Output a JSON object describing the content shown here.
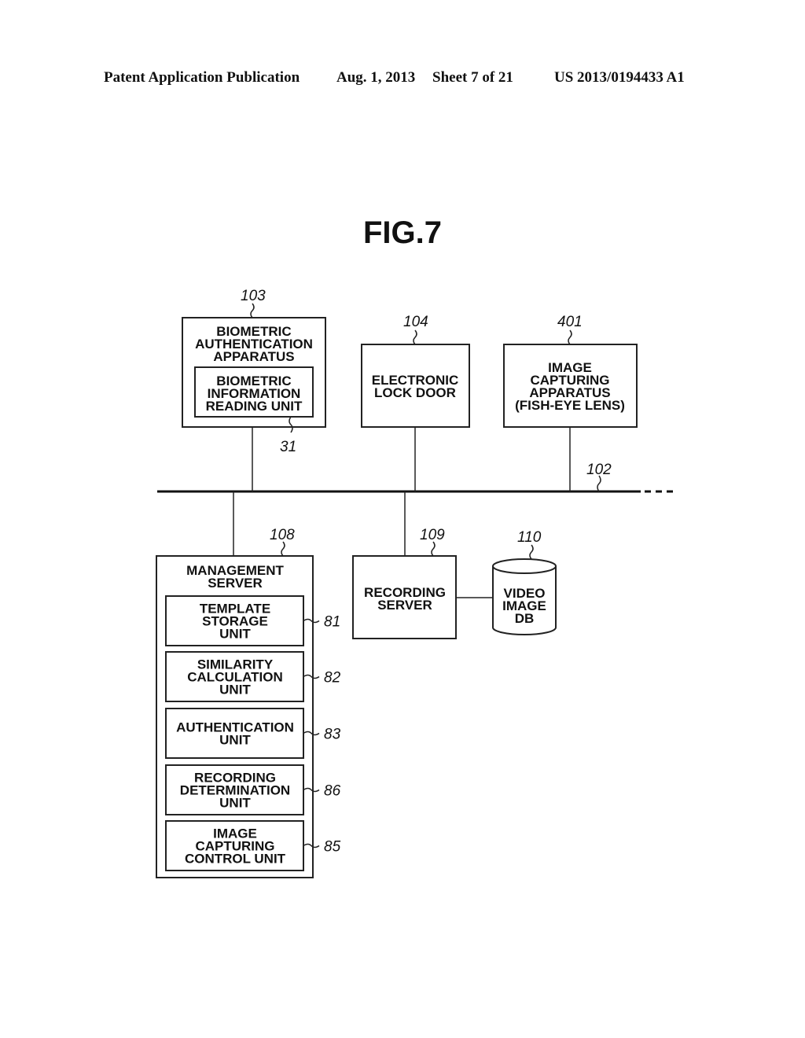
{
  "header": {
    "publication": "Patent Application Publication",
    "date": "Aug. 1, 2013",
    "sheet": "Sheet 7 of 21",
    "number": "US 2013/0194433 A1"
  },
  "figure": {
    "title": "FIG.7"
  },
  "network": {
    "ref": "102"
  },
  "blocks": {
    "biometric_auth": {
      "ref": "103",
      "lines": [
        "BIOMETRIC",
        "AUTHENTICATION",
        "APPARATUS"
      ]
    },
    "biometric_reader": {
      "ref": "31",
      "lines": [
        "BIOMETRIC",
        "INFORMATION",
        "READING UNIT"
      ]
    },
    "lock_door": {
      "ref": "104",
      "lines": [
        "ELECTRONIC",
        "LOCK DOOR"
      ]
    },
    "camera": {
      "ref": "401",
      "lines": [
        "IMAGE",
        "CAPTURING",
        "APPARATUS",
        "(FISH-EYE LENS)"
      ]
    },
    "management_server": {
      "ref": "108",
      "lines": [
        "MANAGEMENT",
        "SERVER"
      ]
    },
    "recording_server": {
      "ref": "109",
      "lines": [
        "RECORDING",
        "SERVER"
      ]
    },
    "video_db": {
      "ref": "110",
      "lines": [
        "VIDEO",
        "IMAGE",
        "DB"
      ]
    }
  },
  "units": [
    {
      "ref": "81",
      "lines": [
        "TEMPLATE",
        "STORAGE",
        "UNIT"
      ]
    },
    {
      "ref": "82",
      "lines": [
        "SIMILARITY",
        "CALCULATION",
        "UNIT"
      ]
    },
    {
      "ref": "83",
      "lines": [
        "AUTHENTICATION",
        "UNIT"
      ]
    },
    {
      "ref": "86",
      "lines": [
        "RECORDING",
        "DETERMINATION",
        "UNIT"
      ]
    },
    {
      "ref": "85",
      "lines": [
        "IMAGE",
        "CAPTURING",
        "CONTROL UNIT"
      ]
    }
  ]
}
